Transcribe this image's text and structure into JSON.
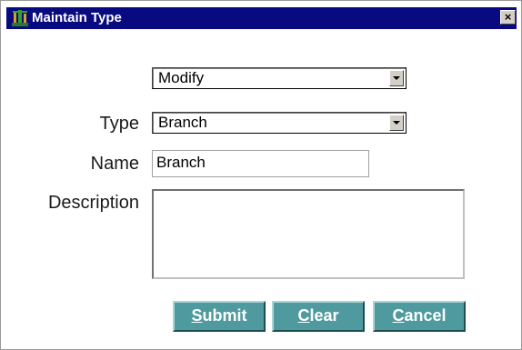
{
  "window": {
    "title": "Maintain Type",
    "icon": "app-tree-icon",
    "close_label": "×"
  },
  "form": {
    "action_select": {
      "value": "Modify"
    },
    "type": {
      "label": "Type",
      "value": "Branch"
    },
    "name": {
      "label": "Name",
      "value": "Branch"
    },
    "description": {
      "label": "Description",
      "value": ""
    }
  },
  "buttons": {
    "submit": {
      "mnemonic": "S",
      "rest": "ubmit"
    },
    "clear": {
      "mnemonic": "C",
      "rest": "lear"
    },
    "cancel": {
      "mnemonic": "C",
      "rest": "ancel"
    }
  },
  "colors": {
    "titlebar": "#0a0a80",
    "button": "#4f9a9e"
  }
}
